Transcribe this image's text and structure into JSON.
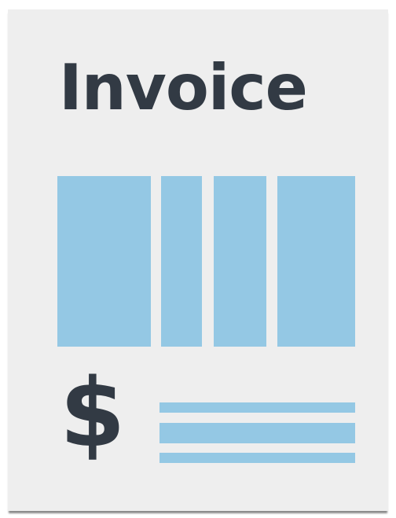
{
  "document": {
    "title": "Invoice",
    "currency_symbol": "$",
    "table_columns": 4,
    "summary_lines": 3
  },
  "colors": {
    "paper": "#eeeeee",
    "ink": "#323a44",
    "accent": "#94c8e4"
  }
}
